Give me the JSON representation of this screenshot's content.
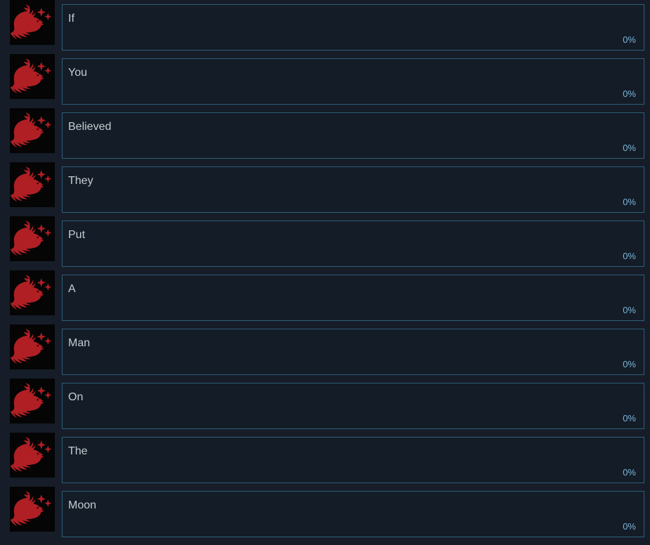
{
  "theme": {
    "page_background": "#161d29",
    "box_background": "#141c27",
    "box_border": "#2e5e77",
    "label_color": "#c6cbd1",
    "percent_color": "#7ab6da",
    "avatar_background": "#050505",
    "avatar_art_color": "#b01f24"
  },
  "list": {
    "avatar_icon": "wolf-head-sparkles-icon",
    "rows": [
      {
        "label": "If",
        "percent": "0%"
      },
      {
        "label": "You",
        "percent": "0%"
      },
      {
        "label": "Believed",
        "percent": "0%"
      },
      {
        "label": "They",
        "percent": "0%"
      },
      {
        "label": "Put",
        "percent": "0%"
      },
      {
        "label": "A",
        "percent": "0%"
      },
      {
        "label": "Man",
        "percent": "0%"
      },
      {
        "label": "On",
        "percent": "0%"
      },
      {
        "label": "The",
        "percent": "0%"
      },
      {
        "label": "Moon",
        "percent": "0%"
      }
    ]
  }
}
